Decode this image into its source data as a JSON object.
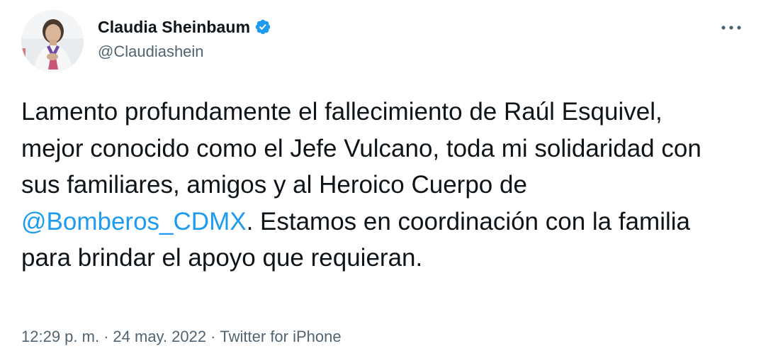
{
  "author": {
    "display_name": "Claudia Sheinbaum",
    "handle": "@Claudiashein",
    "verified": true,
    "avatar_icon": "profile-photo"
  },
  "tweet": {
    "text_before": "Lamento profundamente el fallecimiento de Raúl Esquivel, mejor conocido como el Jefe Vulcano, toda mi solidaridad con sus familiares, amigos y al Heroico Cuerpo de ",
    "mention": "@Bomberos_CDMX",
    "text_after": ". Estamos en coordinación con la familia para brindar el apoyo que requieran."
  },
  "meta": {
    "time": "12:29 p. m.",
    "separator": "·",
    "date": "24 may. 2022",
    "source": "Twitter for iPhone"
  },
  "colors": {
    "accent": "#1d9bf0",
    "text": "#0f1419",
    "secondary": "#536471"
  }
}
